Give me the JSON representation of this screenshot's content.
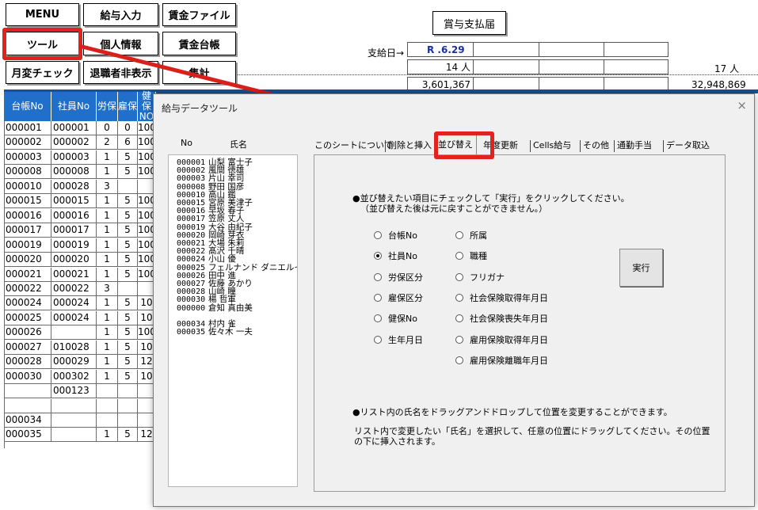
{
  "toolbar": {
    "menu": "MENU",
    "kyuyo_input": "給与入力",
    "chingin_file": "賃金ファイル",
    "tool": "ツール",
    "kojin_joho": "個人情報",
    "chingin_daicho": "賃金台帳",
    "getsuhen_check": "月変チェック",
    "taishokusha_hihyoji": "退職者非表示",
    "shukei": "集計"
  },
  "bonus": {
    "title": "賞与支払届",
    "pay_date_label": "支給日→",
    "pay_date_value": "R  .6.29",
    "count1": "14 人",
    "count2": "17 人",
    "amount1": "3,601,367",
    "amount2": "32,948,869"
  },
  "grid": {
    "headers": [
      "台帳No",
      "社員No",
      "労保",
      "雇保",
      "健保NO"
    ],
    "rows": [
      [
        "000001",
        "000001",
        "0",
        "0",
        "100"
      ],
      [
        "000002",
        "000002",
        "2",
        "6",
        "100"
      ],
      [
        "000003",
        "000003",
        "1",
        "5",
        "100"
      ],
      [
        "000008",
        "000008",
        "1",
        "5",
        "100"
      ],
      [
        "000010",
        "000028",
        "3",
        "",
        ""
      ],
      [
        "000015",
        "000015",
        "1",
        "5",
        "100"
      ],
      [
        "000016",
        "000016",
        "1",
        "5",
        "100"
      ],
      [
        "000017",
        "000017",
        "1",
        "5",
        "100"
      ],
      [
        "000019",
        "000019",
        "1",
        "5",
        "100"
      ],
      [
        "000020",
        "000020",
        "1",
        "5",
        "100"
      ],
      [
        "000021",
        "000021",
        "1",
        "5",
        "100"
      ],
      [
        "000022",
        "000022",
        "3",
        "",
        ""
      ],
      [
        "000024",
        "000024",
        "1",
        "5",
        "10"
      ],
      [
        "000025",
        "000024",
        "1",
        "5",
        "10"
      ],
      [
        "000026",
        "",
        "1",
        "5",
        "1000"
      ],
      [
        "000027",
        "010028",
        "1",
        "5",
        "10"
      ],
      [
        "000028",
        "000029",
        "1",
        "5",
        "12"
      ],
      [
        "000030",
        "000302",
        "1",
        "5",
        "10"
      ],
      [
        "",
        "000123",
        "",
        "",
        ""
      ],
      [
        "",
        "",
        "",
        "",
        ""
      ],
      [
        "000034",
        "",
        "",
        "",
        ""
      ],
      [
        "000035",
        "",
        "1",
        "5",
        "12"
      ]
    ]
  },
  "dialog": {
    "title": "給与データツール",
    "close": "×",
    "list_header_no": "No",
    "list_header_name": "氏名",
    "list_items": [
      [
        "000001",
        "山梨 富士子"
      ],
      [
        "000002",
        "風間 徳雄"
      ],
      [
        "000003",
        "片山 幸司"
      ],
      [
        "000008",
        "野田 国彦"
      ],
      [
        "000010",
        "高山 鑑"
      ],
      [
        "000015",
        "宮原 美津子"
      ],
      [
        "000016",
        "早坂 春子"
      ],
      [
        "000017",
        "笠原 丈人"
      ],
      [
        "000019",
        "大谷 由紀子"
      ],
      [
        "000020",
        "岡崎 芽衣"
      ],
      [
        "000021",
        "大場 朱莉"
      ],
      [
        "000022",
        "髙沢 千晴"
      ],
      [
        "000024",
        "小山 優"
      ],
      [
        "000025",
        "フェルナンド ダニエルイサ"
      ],
      [
        "000026",
        "田中 進"
      ],
      [
        "000027",
        "佐藤 あかり"
      ],
      [
        "000028",
        "山崎 瞳"
      ],
      [
        "000030",
        "楊 哲軍"
      ],
      [
        "000000",
        "倉知 真由美"
      ],
      [
        "000034",
        "村内 雀"
      ],
      [
        "000035",
        "佐々木 一夫"
      ]
    ],
    "tabs": [
      "このシートについて",
      "削除と挿入",
      "並び替え",
      "年度更新",
      "Cells給与",
      "その他",
      "通勤手当",
      "データ取込"
    ],
    "instruction1": "●並び替えたい項目にチェックして「実行」をクリックしてください。",
    "instruction1b": "（並び替えた後は元に戻すことができません。）",
    "radios_left": [
      "台帳No",
      "社員No",
      "労保区分",
      "雇保区分",
      "健保No",
      "生年月日"
    ],
    "radios_right": [
      "所属",
      "職種",
      "フリガナ",
      "社会保険取得年月日",
      "社会保険喪失年月日",
      "雇用保険取得年月日",
      "雇用保険離職年月日"
    ],
    "selected": "社員No",
    "execute": "実行",
    "note_heading": "●リスト内の氏名をドラッグアンドドロップして位置を変更することができます。",
    "note_body1": "リスト内で変更したい「氏名」を選択して、任意の位置にドラッグしてください。その位置",
    "note_body2": "の下に挿入されます。"
  },
  "colors": {
    "grid_header": "#1f6fcb",
    "highlight_red": "#e1221d",
    "dialog_bg": "#f0f0f0"
  }
}
